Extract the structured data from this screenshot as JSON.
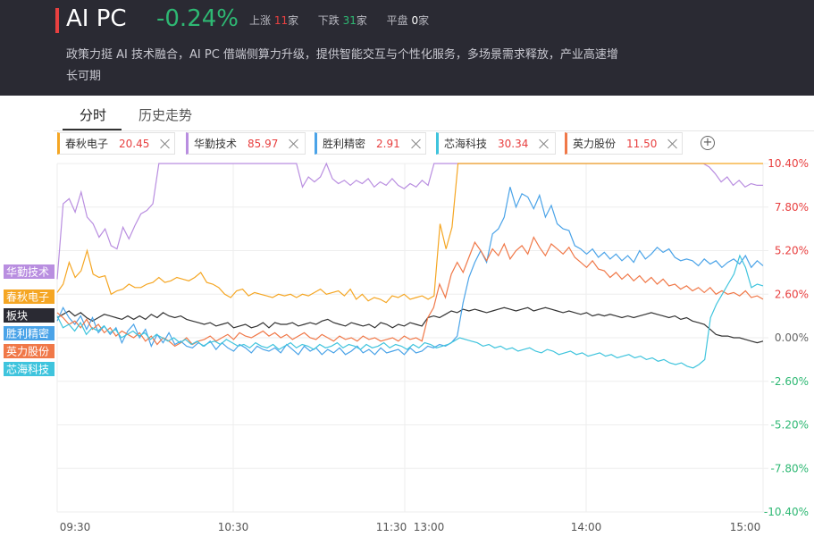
{
  "header": {
    "title": "AI PC",
    "change_pct": "-0.24%",
    "up_label": "上涨",
    "up_count": "11",
    "up_unit": "家",
    "down_label": "下跌",
    "down_count": "31",
    "down_unit": "家",
    "flat_label": "平盘",
    "flat_count": "0",
    "flat_unit": "家",
    "description": "政策力挺 AI 技术融合，AI PC 借端侧算力升级，提供智能交互与个性化服务，多场景需求释放，产业高速增长可期",
    "accent_color": "#e84040"
  },
  "tabs": [
    {
      "label": "分时",
      "active": true
    },
    {
      "label": "历史走势",
      "active": false
    }
  ],
  "chips": [
    {
      "name": "春秋电子",
      "value": "20.45",
      "color": "#f5a623"
    },
    {
      "name": "华勤技术",
      "value": "85.97",
      "color": "#b98ee0"
    },
    {
      "name": "胜利精密",
      "value": "2.91",
      "color": "#4aa3e8"
    },
    {
      "name": "芯海科技",
      "value": "30.34",
      "color": "#3fc4dd"
    },
    {
      "name": "英力股份",
      "value": "11.50",
      "color": "#f07848"
    }
  ],
  "chart_data": {
    "type": "line",
    "x_ticks": [
      "09:30",
      "10:30",
      "11:30",
      "13:00",
      "14:00",
      "15:00"
    ],
    "y_ticks": [
      "10.40%",
      "7.80%",
      "5.20%",
      "2.60%",
      "0.00%",
      "-2.60%",
      "-5.20%",
      "-7.80%",
      "-10.40%"
    ],
    "ylim": [
      -10.4,
      10.4
    ],
    "grid": true,
    "series": [
      {
        "name": "华勤技术",
        "color": "#b98ee0",
        "label_color": "#b98ee0",
        "values": [
          3.5,
          8.0,
          8.3,
          7.5,
          8.7,
          7.2,
          6.8,
          6.0,
          6.5,
          5.5,
          5.3,
          6.6,
          5.9,
          6.7,
          7.4,
          7.6,
          8.0,
          10.4,
          10.4,
          10.4,
          10.4,
          10.4,
          10.4,
          10.4,
          10.4,
          10.4,
          10.4,
          10.4,
          10.4,
          10.4,
          10.4,
          10.4,
          10.4,
          10.4,
          10.4,
          10.4,
          10.4,
          10.4,
          10.4,
          10.4,
          10.4,
          9.0,
          9.6,
          9.3,
          9.6,
          10.4,
          9.5,
          9.2,
          9.4,
          9.1,
          9.4,
          9.2,
          9.5,
          9.0,
          9.3,
          9.1,
          9.5,
          9.1,
          8.9,
          9.2,
          9.0,
          9.4,
          9.1,
          10.4,
          10.4,
          10.4,
          10.4,
          10.4,
          10.4,
          10.4,
          10.4,
          10.4,
          10.4,
          10.4,
          10.4,
          10.4,
          10.4,
          10.4,
          10.4,
          10.4,
          10.4,
          10.4,
          10.4,
          10.4,
          10.4,
          10.4,
          10.4,
          10.4,
          10.4,
          10.4,
          10.4,
          10.4,
          10.4,
          10.4,
          10.4,
          10.4,
          10.4,
          10.4,
          10.4,
          10.4,
          10.4,
          10.4,
          10.4,
          10.4,
          10.4,
          10.4,
          10.4,
          10.4,
          10.4,
          10.2,
          9.8,
          9.3,
          9.6,
          9.1,
          9.4,
          9.0,
          9.2,
          9.1,
          9.1
        ]
      },
      {
        "name": "春秋电子",
        "color": "#f5a623",
        "label_color": "#f5a623",
        "values": [
          2.7,
          3.2,
          4.5,
          3.6,
          4.0,
          5.2,
          3.8,
          3.6,
          3.7,
          2.6,
          2.8,
          2.9,
          3.2,
          3.0,
          3.0,
          3.2,
          3.3,
          3.6,
          3.3,
          3.4,
          3.6,
          3.5,
          3.4,
          3.6,
          3.9,
          3.3,
          3.2,
          3.0,
          2.6,
          2.4,
          2.8,
          2.9,
          2.5,
          2.7,
          2.6,
          2.5,
          2.4,
          2.6,
          2.5,
          2.6,
          2.4,
          2.6,
          2.5,
          2.7,
          2.9,
          2.6,
          2.7,
          2.8,
          2.5,
          2.9,
          2.3,
          2.6,
          2.2,
          2.4,
          2.3,
          2.1,
          2.5,
          2.4,
          2.6,
          2.3,
          2.4,
          2.5,
          2.3,
          2.5,
          6.8,
          5.3,
          6.6,
          10.4,
          10.4,
          10.4,
          10.4,
          10.4,
          10.4,
          10.4,
          10.4,
          10.4,
          10.4,
          10.4,
          10.4,
          10.4,
          10.4,
          10.4,
          10.4,
          10.4,
          10.4,
          10.4,
          10.4,
          10.4,
          10.4,
          10.4,
          10.4,
          10.4,
          10.4,
          10.4,
          10.4,
          10.4,
          10.4,
          10.4,
          10.4,
          10.4,
          10.4,
          10.4,
          10.4,
          10.4,
          10.4,
          10.4,
          10.4,
          10.4,
          10.4,
          10.4,
          10.4,
          10.4,
          10.4,
          10.4,
          10.4,
          10.4,
          10.4,
          10.4,
          10.4
        ]
      },
      {
        "name": "板块",
        "color": "#333333",
        "label_color": "#2a2a33",
        "values": [
          1.2,
          1.4,
          1.6,
          1.3,
          1.5,
          1.2,
          1.0,
          1.2,
          1.4,
          1.3,
          1.2,
          1.1,
          1.3,
          1.1,
          1.3,
          1.1,
          1.4,
          1.2,
          1.5,
          1.3,
          1.2,
          1.3,
          1.1,
          1.0,
          0.9,
          0.8,
          0.9,
          0.7,
          0.8,
          0.9,
          0.6,
          0.7,
          0.8,
          0.6,
          0.7,
          0.9,
          0.6,
          0.9,
          0.8,
          0.8,
          0.9,
          0.7,
          0.8,
          0.9,
          0.8,
          1.0,
          1.1,
          0.9,
          0.8,
          0.7,
          0.9,
          0.8,
          0.7,
          0.8,
          0.6,
          0.9,
          0.8,
          0.6,
          0.8,
          0.7,
          0.9,
          0.8,
          0.7,
          1.2,
          1.3,
          1.2,
          1.4,
          1.6,
          1.5,
          1.7,
          1.6,
          1.7,
          1.6,
          1.5,
          1.6,
          1.7,
          1.8,
          1.7,
          1.6,
          1.7,
          1.8,
          1.6,
          1.7,
          1.8,
          1.7,
          1.6,
          1.5,
          1.6,
          1.5,
          1.4,
          1.5,
          1.3,
          1.4,
          1.3,
          1.4,
          1.3,
          1.2,
          1.3,
          1.2,
          1.3,
          1.4,
          1.5,
          1.4,
          1.3,
          1.2,
          1.3,
          1.1,
          1.2,
          1.0,
          0.9,
          0.8,
          0.5,
          0.2,
          0.1,
          0.1,
          0.0,
          0.0,
          -0.1,
          -0.2,
          -0.3,
          -0.2
        ]
      },
      {
        "name": "胜利精密",
        "color": "#4aa3e8",
        "label_color": "#4aa3e8",
        "values": [
          1.0,
          1.8,
          1.2,
          0.8,
          1.3,
          0.5,
          1.2,
          0.3,
          0.7,
          0.2,
          0.6,
          -0.3,
          0.4,
          0.8,
          0.0,
          0.5,
          -0.5,
          0.2,
          -0.3,
          0.3,
          -0.4,
          -0.2,
          -0.5,
          -0.6,
          -0.3,
          -0.5,
          -0.2,
          -0.7,
          -0.3,
          -0.6,
          -0.8,
          -0.4,
          -0.6,
          -0.9,
          -0.5,
          -0.7,
          -0.8,
          -0.6,
          -0.9,
          -0.4,
          -0.7,
          -1.0,
          -0.5,
          -0.8,
          -0.6,
          -1.0,
          -0.7,
          -0.9,
          -0.6,
          -1.0,
          -0.8,
          -0.5,
          -0.9,
          -0.7,
          -1.0,
          -0.6,
          -0.9,
          -0.8,
          -0.7,
          -1.0,
          -0.6,
          -0.9,
          -0.8,
          -0.5,
          -0.6,
          -0.4,
          -0.5,
          -0.3,
          0.1,
          2.1,
          3.6,
          4.5,
          5.2,
          4.5,
          6.2,
          6.5,
          7.2,
          9.0,
          7.8,
          8.6,
          8.4,
          7.7,
          8.5,
          7.2,
          7.9,
          6.8,
          6.5,
          6.4,
          5.5,
          5.3,
          5.0,
          5.3,
          4.8,
          5.1,
          4.7,
          5.0,
          4.6,
          4.9,
          4.5,
          5.2,
          4.7,
          5.0,
          5.4,
          5.1,
          5.3,
          4.8,
          4.6,
          4.7,
          4.6,
          4.3,
          4.7,
          4.4,
          4.6,
          4.2,
          4.5,
          4.7,
          4.4,
          4.9,
          4.2,
          4.6,
          4.3
        ]
      },
      {
        "name": "英力股份",
        "color": "#f07848",
        "label_color": "#f07848",
        "values": [
          1.5,
          1.2,
          0.8,
          1.0,
          0.6,
          1.1,
          0.5,
          0.8,
          0.3,
          0.6,
          0.1,
          0.4,
          0.2,
          0.0,
          0.3,
          -0.2,
          0.1,
          -0.4,
          0.0,
          -0.2,
          -0.5,
          -0.3,
          0.0,
          -0.4,
          -0.2,
          -0.1,
          0.1,
          -0.2,
          0.0,
          0.2,
          -0.1,
          0.3,
          0.1,
          0.0,
          0.2,
          0.4,
          0.1,
          0.3,
          0.0,
          0.2,
          -0.1,
          0.1,
          0.3,
          0.0,
          -0.1,
          0.2,
          0.0,
          -0.2,
          0.1,
          -0.1,
          0.0,
          -0.2,
          0.1,
          -0.1,
          0.0,
          -0.2,
          -0.1,
          0.0,
          -0.2,
          0.1,
          -0.1,
          0.0,
          -0.2,
          1.2,
          1.8,
          3.2,
          2.4,
          3.8,
          4.5,
          3.9,
          4.8,
          5.7,
          5.2,
          4.6,
          5.3,
          4.9,
          5.6,
          4.7,
          5.2,
          5.5,
          5.0,
          6.0,
          5.4,
          4.9,
          5.6,
          5.3,
          5.0,
          5.4,
          4.8,
          4.5,
          4.2,
          4.6,
          4.1,
          4.0,
          3.6,
          3.9,
          3.5,
          3.8,
          3.4,
          3.7,
          3.3,
          3.6,
          3.2,
          3.5,
          3.1,
          3.2,
          2.9,
          3.1,
          2.8,
          3.0,
          2.7,
          3.0,
          2.6,
          2.8,
          2.6,
          2.7,
          2.5,
          2.8,
          2.4,
          2.5,
          2.3
        ]
      },
      {
        "name": "芯海科技",
        "color": "#3fc4dd",
        "label_color": "#3fc4dd",
        "values": [
          1.3,
          0.6,
          0.8,
          0.4,
          0.9,
          0.2,
          0.6,
          0.4,
          0.7,
          0.3,
          0.5,
          0.0,
          0.2,
          0.4,
          0.1,
          0.3,
          -0.1,
          0.2,
          0.0,
          -0.2,
          0.0,
          -0.3,
          -0.1,
          -0.4,
          -0.2,
          -0.5,
          -0.3,
          -0.2,
          -0.4,
          -0.1,
          -0.3,
          -0.5,
          -0.4,
          -0.6,
          -0.3,
          -0.5,
          -0.6,
          -0.4,
          -0.7,
          -0.5,
          -0.3,
          -0.6,
          -0.4,
          -0.5,
          -0.7,
          -0.4,
          -0.6,
          -0.5,
          -0.3,
          -0.6,
          -0.4,
          -0.5,
          -0.7,
          -0.4,
          -0.6,
          -0.5,
          -0.3,
          -0.6,
          -0.4,
          -0.5,
          -0.7,
          -0.4,
          -0.6,
          -0.3,
          -0.4,
          -0.6,
          -0.5,
          -0.4,
          -0.2,
          0.0,
          -0.1,
          -0.2,
          -0.3,
          -0.5,
          -0.4,
          -0.6,
          -0.5,
          -0.7,
          -0.6,
          -0.8,
          -0.7,
          -0.6,
          -0.8,
          -0.9,
          -0.7,
          -0.8,
          -1.0,
          -0.9,
          -0.8,
          -1.0,
          -0.9,
          -1.1,
          -1.0,
          -0.9,
          -1.1,
          -1.0,
          -1.2,
          -1.1,
          -1.0,
          -1.2,
          -1.1,
          -1.3,
          -1.2,
          -1.4,
          -1.3,
          -1.5,
          -1.6,
          -1.5,
          -1.7,
          -1.8,
          -1.6,
          -1.3,
          1.2,
          2.0,
          2.6,
          3.2,
          3.8,
          4.9,
          4.2,
          3.0,
          3.2,
          3.1
        ]
      }
    ]
  }
}
